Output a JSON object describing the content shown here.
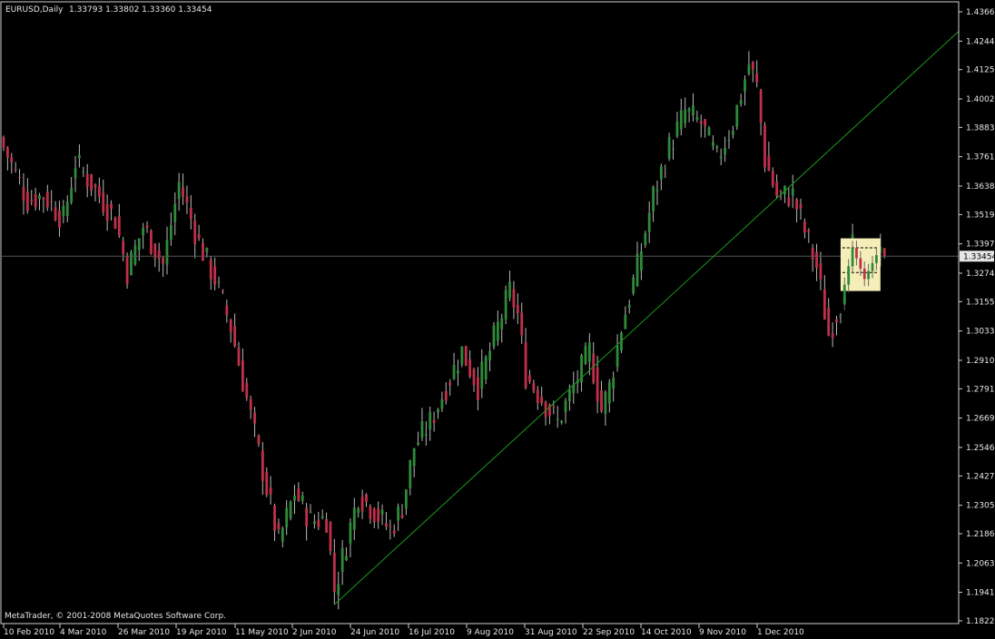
{
  "header": {
    "symbol": "EURUSD,Daily",
    "ohlc": "1.33793 1.33802 1.33360 1.33454"
  },
  "watermark": "MetaTrader, © 2001-2008 MetaQuotes Software Corp.",
  "current_price_label": "1.33454",
  "colors": {
    "background": "#000000",
    "frame": "#d0d0d0",
    "bull": "#2e8b3a",
    "bear": "#c0304a",
    "wick": "#b8b8b8",
    "trendline": "#1a9a1a",
    "highlight": "#f5eeb8"
  },
  "chart_data": {
    "type": "candlestick",
    "symbol": "EURUSD",
    "timeframe": "Daily",
    "ylim": [
      1.1822,
      1.43665
    ],
    "y_ticks": [
      "1.43665",
      "1.42440",
      "1.41250",
      "1.40025",
      "1.38835",
      "1.37610",
      "1.36385",
      "1.35195",
      "1.33970",
      "1.32745",
      "1.31555",
      "1.30330",
      "1.29105",
      "1.27915",
      "1.26690",
      "1.25465",
      "1.24275",
      "1.23050",
      "1.21860",
      "1.20635",
      "1.19410",
      "1.18220"
    ],
    "x_ticks": [
      "10 Feb 2010",
      "4 Mar 2010",
      "26 Mar 2010",
      "19 Apr 2010",
      "11 May 2010",
      "2 Jun 2010",
      "24 Jun 2010",
      "16 Jul 2010",
      "9 Aug 2010",
      "31 Aug 2010",
      "22 Sep 2010",
      "14 Oct 2010",
      "9 Nov 2010",
      "1 Dec 2010"
    ],
    "anchors": [
      [
        0,
        1.38
      ],
      [
        6,
        1.358
      ],
      [
        10,
        1.36
      ],
      [
        15,
        1.35
      ],
      [
        18,
        1.374
      ],
      [
        24,
        1.36
      ],
      [
        28,
        1.35
      ],
      [
        31,
        1.328
      ],
      [
        35,
        1.347
      ],
      [
        40,
        1.331
      ],
      [
        44,
        1.365
      ],
      [
        49,
        1.34
      ],
      [
        53,
        1.325
      ],
      [
        57,
        1.305
      ],
      [
        61,
        1.275
      ],
      [
        65,
        1.245
      ],
      [
        69,
        1.215
      ],
      [
        73,
        1.236
      ],
      [
        77,
        1.224
      ],
      [
        81,
        1.225
      ],
      [
        83,
        1.195
      ],
      [
        86,
        1.215
      ],
      [
        89,
        1.235
      ],
      [
        93,
        1.228
      ],
      [
        97,
        1.22
      ],
      [
        100,
        1.23
      ],
      [
        103,
        1.255
      ],
      [
        107,
        1.265
      ],
      [
        111,
        1.28
      ],
      [
        115,
        1.295
      ],
      [
        119,
        1.28
      ],
      [
        123,
        1.3
      ],
      [
        127,
        1.32
      ],
      [
        129,
        1.31
      ],
      [
        131,
        1.285
      ],
      [
        135,
        1.275
      ],
      [
        139,
        1.265
      ],
      [
        143,
        1.28
      ],
      [
        147,
        1.295
      ],
      [
        150,
        1.27
      ],
      [
        152,
        1.28
      ],
      [
        155,
        1.305
      ],
      [
        159,
        1.33
      ],
      [
        163,
        1.36
      ],
      [
        167,
        1.38
      ],
      [
        171,
        1.395
      ],
      [
        175,
        1.39
      ],
      [
        179,
        1.375
      ],
      [
        183,
        1.39
      ],
      [
        187,
        1.415
      ],
      [
        189,
        1.405
      ],
      [
        191,
        1.375
      ],
      [
        194,
        1.36
      ],
      [
        198,
        1.36
      ],
      [
        201,
        1.345
      ],
      [
        204,
        1.33
      ],
      [
        207,
        1.302
      ],
      [
        210,
        1.315
      ],
      [
        213,
        1.338
      ],
      [
        216,
        1.325
      ],
      [
        219,
        1.335
      ],
      [
        221,
        1.3345
      ]
    ],
    "last_bar": {
      "open": 1.33793,
      "high": 1.33802,
      "low": 1.3336,
      "close": 1.33454
    },
    "current_price": 1.33454,
    "trendline": {
      "from": {
        "bar": 83,
        "price": 1.189
      },
      "to": {
        "bar": 221,
        "price": 1.4
      }
    },
    "highlight_box": {
      "bars": [
        210,
        220
      ],
      "price_range": [
        1.32,
        1.342
      ]
    },
    "grid": false
  }
}
